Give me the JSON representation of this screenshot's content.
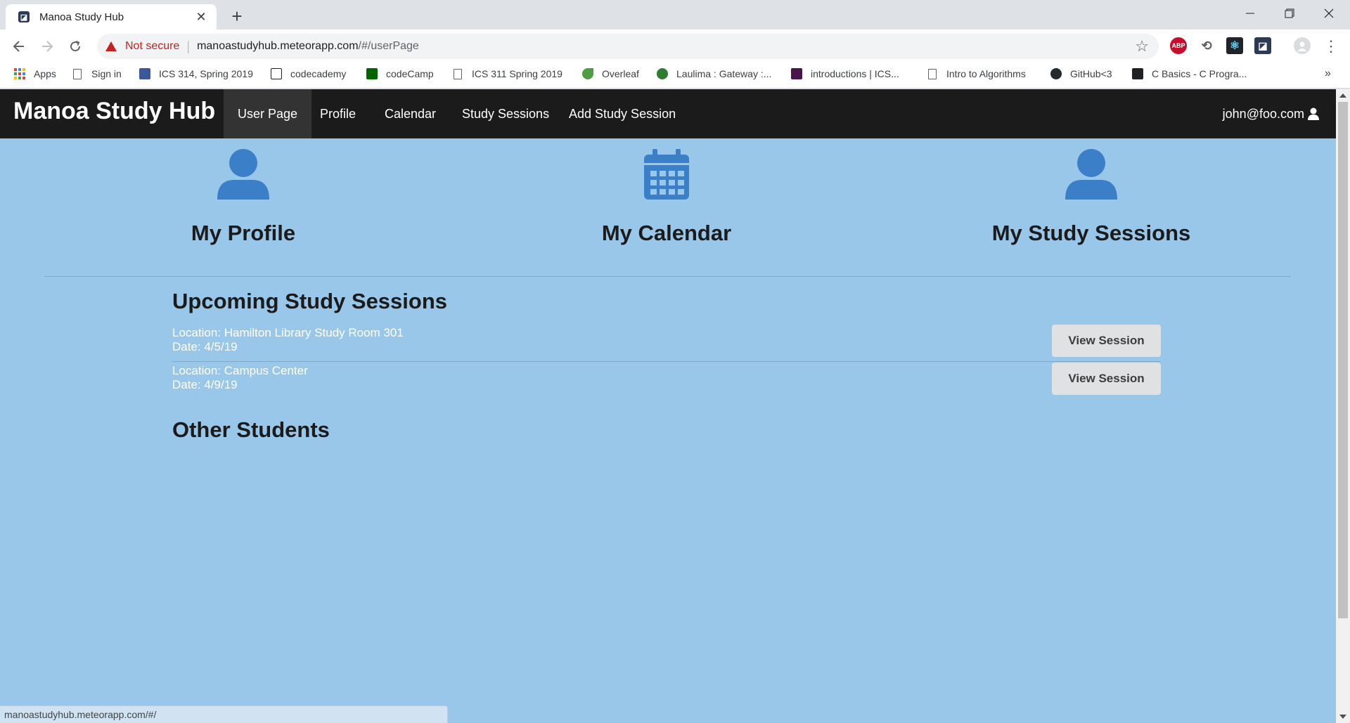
{
  "browser": {
    "tab_title": "Manoa Study Hub",
    "tab_close": "✕",
    "new_tab": "+",
    "security_label": "Not secure",
    "url_host": "manoastudyhub.meteorapp.com",
    "url_path": "/#/userPage",
    "status_url": "manoastudyhub.meteorapp.com/#/",
    "bookmarks": [
      {
        "label": "Apps",
        "icon": "apps-grid-icon"
      },
      {
        "label": "Sign in",
        "icon": "document-icon"
      },
      {
        "label": "ICS 314, Spring 2019",
        "icon": "ics314-icon"
      },
      {
        "label": "codecademy",
        "icon": "codecademy-icon"
      },
      {
        "label": "codeCamp",
        "icon": "codecamp-icon"
      },
      {
        "label": "ICS 311 Spring 2019",
        "icon": "document-icon"
      },
      {
        "label": "Overleaf",
        "icon": "overleaf-icon"
      },
      {
        "label": "Laulima : Gateway :...",
        "icon": "laulima-icon"
      },
      {
        "label": "introductions | ICS...",
        "icon": "slack-icon"
      },
      {
        "label": "Intro to Algorithms",
        "icon": "document-icon"
      },
      {
        "label": "GitHub<3",
        "icon": "github-icon"
      },
      {
        "label": "C Basics - C Progra...",
        "icon": "terminal-icon"
      }
    ],
    "bookmarks_overflow": "»",
    "extensions": [
      {
        "label": "ABP",
        "color": "#c70d2c"
      },
      {
        "label": "⟲",
        "color": "#5f6368"
      },
      {
        "label": "⚛",
        "color": "#20232a"
      },
      {
        "label": "◪",
        "color": "#2b3a55"
      }
    ]
  },
  "navbar": {
    "brand": "Manoa Study Hub",
    "links": [
      "User Page",
      "Profile",
      "Calendar",
      "Study Sessions",
      "Add Study Session"
    ],
    "active_link": "User Page",
    "user_email": "john@foo.com"
  },
  "features": [
    {
      "title": "My Profile",
      "icon": "user-icon"
    },
    {
      "title": "My Calendar",
      "icon": "calendar-icon"
    },
    {
      "title": "My Study Sessions",
      "icon": "user-icon"
    }
  ],
  "upcoming": {
    "title": "Upcoming Study Sessions",
    "sessions": [
      {
        "location": "Location: Hamilton Library Study Room 301",
        "date": "Date: 4/5/19",
        "button": "View Session"
      },
      {
        "location": "Location: Campus Center",
        "date": "Date: 4/9/19",
        "button": "View Session"
      }
    ]
  },
  "other_students": {
    "title": "Other Students"
  },
  "colors": {
    "page_bg": "#99c7ea",
    "navbar_bg": "#1b1b1b",
    "icon_blue": "#3a7fc7"
  }
}
